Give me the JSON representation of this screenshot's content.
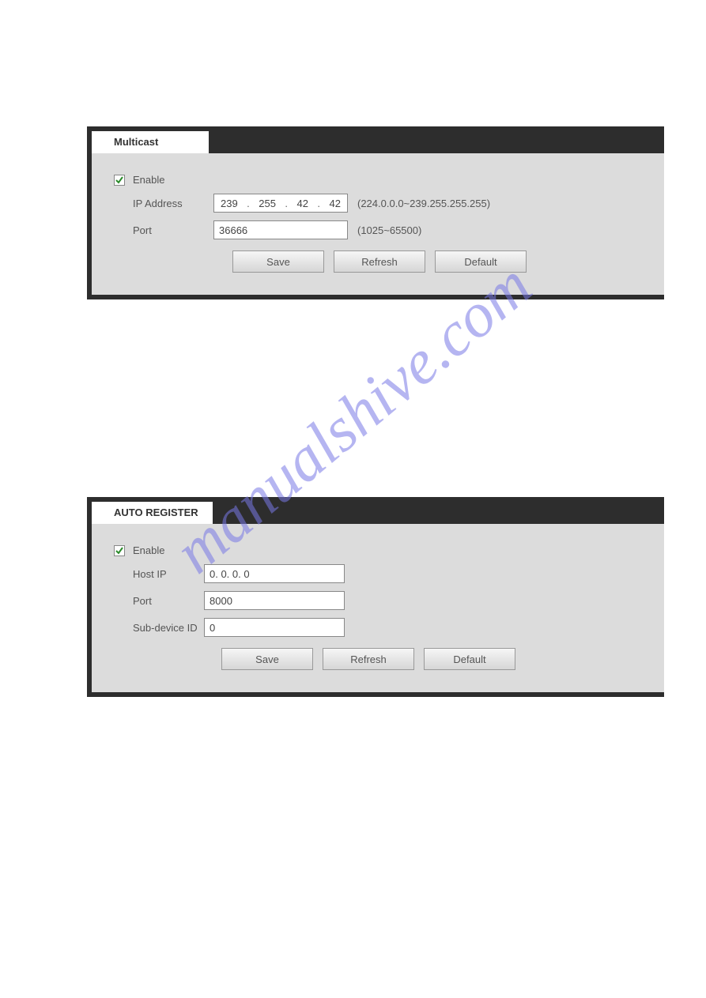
{
  "watermark": "manualshive.com",
  "multicast": {
    "tab": "Multicast",
    "enable_label": "Enable",
    "enable_checked": true,
    "ip_label": "IP Address",
    "ip_octets": [
      "239",
      "255",
      "42",
      "42"
    ],
    "ip_hint": "(224.0.0.0~239.255.255.255)",
    "port_label": "Port",
    "port_value": "36666",
    "port_hint": "(1025~65500)",
    "save": "Save",
    "refresh": "Refresh",
    "default": "Default"
  },
  "autoreg": {
    "tab": "AUTO REGISTER",
    "enable_label": "Enable",
    "enable_checked": true,
    "hostip_label": "Host IP",
    "hostip_value": "0. 0. 0. 0",
    "port_label": "Port",
    "port_value": "8000",
    "subdev_label": "Sub-device ID",
    "subdev_value": "0",
    "save": "Save",
    "refresh": "Refresh",
    "default": "Default"
  }
}
